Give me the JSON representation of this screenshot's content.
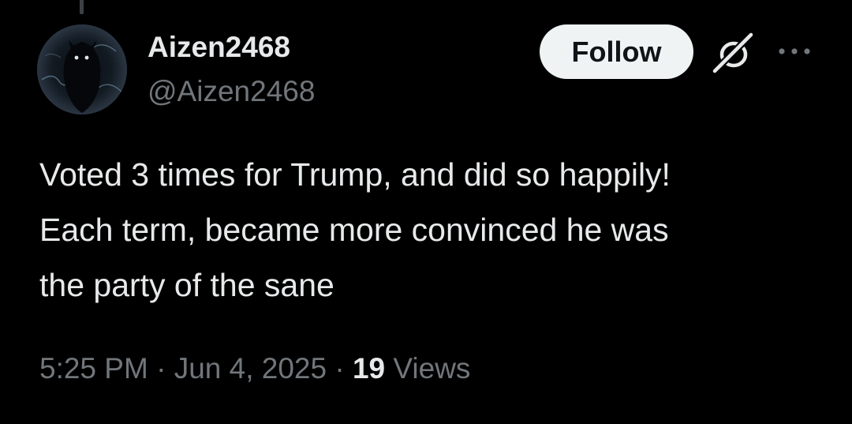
{
  "user": {
    "display_name": "Aizen2468",
    "handle": "@Aizen2468"
  },
  "actions": {
    "follow_label": "Follow",
    "grok_icon": "grok-icon",
    "more_icon": "more-options-icon"
  },
  "tweet": {
    "lines": [
      "Voted 3 times for Trump, and did so happily!",
      "Each term, became more convinced he was",
      "the party of the sane"
    ],
    "time": "5:25 PM",
    "separator": "·",
    "date": "Jun 4, 2025",
    "views_count": "19",
    "views_label": "Views"
  },
  "colors": {
    "background": "#000000",
    "primary_text": "#e7e9ea",
    "secondary_text": "#71767b",
    "follow_button_bg": "#eff3f4",
    "follow_button_text": "#0f1419"
  }
}
